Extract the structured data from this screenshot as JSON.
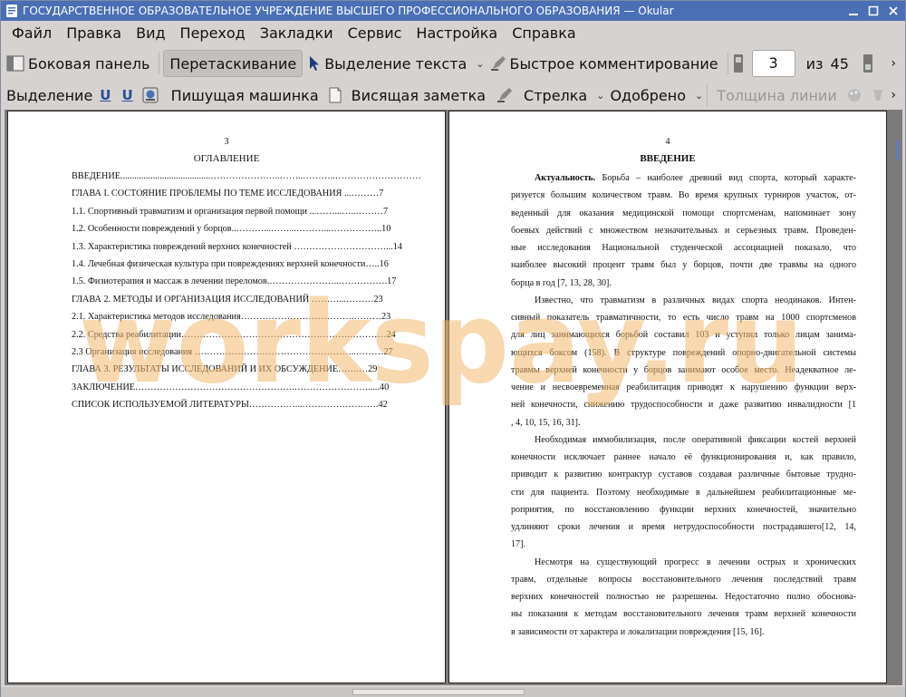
{
  "window": {
    "title": "ГОСУДАРСТВЕННОЕ ОБРАЗОВАТЕЛЬНОЕ УЧРЕЖДЕНИЕ ВЫСШЕГО ПРОФЕССИОНАЛЬНОГО ОБРАЗОВАНИЯ  — Okular"
  },
  "menu": [
    "Файл",
    "Правка",
    "Вид",
    "Переход",
    "Закладки",
    "Сервис",
    "Настройка",
    "Справка"
  ],
  "toolbar1": {
    "sidebar": "Боковая панель",
    "drag": "Перетаскивание",
    "text_select": "Выделение текста",
    "quick_comment": "Быстрое комментирование",
    "page_current": "3",
    "page_of": "из",
    "page_total": "45"
  },
  "toolbar2": {
    "selection": "Выделение",
    "typewriter": "Пишущая машинка",
    "hanging_note": "Висящая заметка",
    "arrow": "Стрелка",
    "approved": "Одобрено",
    "line_width": "Толщина линии"
  },
  "left_page": {
    "number": "3",
    "title": "ОГЛАВЛЕНИЕ",
    "toc": [
      "ВВЕДЕНИЕ.......................................…………………..……..………..………………………….......4",
      "ГЛАВА I. СОСТОЯНИЕ ПРОБЛЕМЫ ПО ТЕМЕ ИССЛЕДОВАНИЯ ...………7",
      "1.1. Спортивный травматизм и организация первой помощи ...……...…..………7",
      "1.2. Особенности повреждений у борцов..………...……...………...……………..10",
      "1.3. Характеристика повреждений верхних конечностей …………………………...14",
      "1.4. Лечебная физическая культура при повреждениях верхней конечности…..16",
      "1.5. Физиотерапия и массаж в лечении переломов.…………………..…………….17",
      "ГЛАВА 2. МЕТОДЫ И ОРГАНИЗАЦИЯ ИССЛЕДОВАНИЙ ………...………23",
      "2.1. Характеристика методов исследования……………………………….………23",
      "2.2. Средства реабилитации……………………………………………….…………24",
      "2.3 Организация исследования ……………………………………………..………27",
      "ГЛАВА 3. РЕЗУЛЬТАТЫ ИССЛЕДОВАНИЙ И ИХ ОБСУЖДЕНИЕ…….…29",
      "ЗАКЛЮЧЕНИЕ…………………………………………….…………………….....40",
      "СПИСОК ИСПОЛЬЗУЕМОЙ ЛИТЕРАТУРЫ……………...…………………….42"
    ]
  },
  "right_page": {
    "number": "4",
    "title": "ВВЕДЕНИЕ",
    "lead_bold": "Актуальность.",
    "lines": [
      " Борьба – наиболее древний вид спорта, который характе-",
      "ризуется большим количеством травм. Во время крупных турниров участок, от-",
      "веденный для оказания медицинской помощи спортсменам, напоминает зону",
      "боевых действий с множеством незначительных и серьезных травм. Проведен-",
      "ные исследования Национальной студенческой ассоциацией показало, что",
      "наиболее высокий процент травм был у борцов, почти две травмы на одного",
      "борца в год [7, 13, 28, 30].",
      "Известно, что травматизм в различных видах спорта неодинаков. Интен-",
      "сивный показатель травматичности, то есть число травм на 1000 спортсменов",
      "для лиц занимающихся борьбой составил 103 и уступил только лицам занима-",
      "ющихся боксом (158). В структуре повреждений опорно-двигательной системы",
      "травмы верхней конечности у борцов занимают особое место. Неадекватное ле-",
      "чение и несвоевременная реабилитация приводят к нарушению функции верх-",
      "ней конечности, снижению трудоспособности и даже развитию инвалидности [1",
      ", 4, 10, 15, 16, 31].",
      "Необходимая иммобилизация, после оперативной фиксации костей верхней",
      "конечности исключает раннее начало её функционирования и, как правило,",
      "приводит к развитию контрактур суставов создавая различные бытовые трудно-",
      "сти для пациента. Поэтому необходимые в дальнейшем реабилитационные ме-",
      "роприятия, по восстановлению функции верхних конечностей, значительно",
      "удлиняют сроки лечения и время нетрудоспособности пострадавшего[12, 14,",
      "17].",
      "Несмотря на существующий прогресс в лечении острых и хронических",
      "травм, отдельные вопросы восстановительного лечения последствий травм",
      "верхних конечностей полностью не разрешены. Недостаточно полно обоснова-",
      "ны показания к методам восстановительного лечения травм верхней конечности",
      "в зависимости от характера и локализации повреждения [15, 16]."
    ]
  },
  "watermark": "workspay.ru",
  "colors": {
    "titlebar": "#4a6fb5",
    "chrome": "#d6d2d0",
    "viewport": "#7d7b79",
    "watermark": "#f0b86e"
  }
}
